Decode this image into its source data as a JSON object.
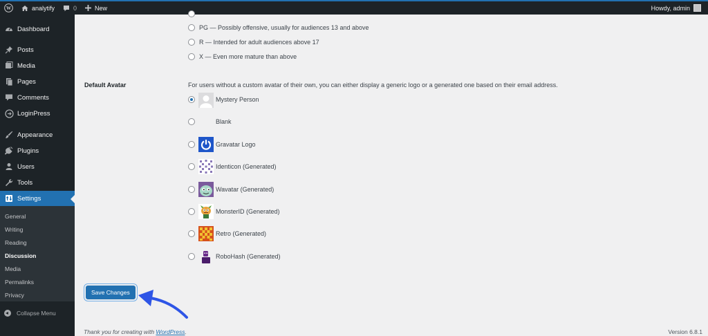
{
  "adminbar": {
    "site_name": "analytify",
    "comments_count": "0",
    "new_label": "New",
    "howdy": "Howdy, admin"
  },
  "sidebar": {
    "items": [
      {
        "label": "Dashboard",
        "icon": "dashboard-icon"
      },
      {
        "label": "Posts",
        "icon": "pin-icon"
      },
      {
        "label": "Media",
        "icon": "media-icon"
      },
      {
        "label": "Pages",
        "icon": "pages-icon"
      },
      {
        "label": "Comments",
        "icon": "comment-icon"
      },
      {
        "label": "LoginPress",
        "icon": "loginpress-icon"
      },
      {
        "label": "Appearance",
        "icon": "brush-icon"
      },
      {
        "label": "Plugins",
        "icon": "plugin-icon"
      },
      {
        "label": "Users",
        "icon": "users-icon"
      },
      {
        "label": "Tools",
        "icon": "wrench-icon"
      },
      {
        "label": "Settings",
        "icon": "settings-icon",
        "active": true
      }
    ],
    "submenu": [
      "General",
      "Writing",
      "Reading",
      "Discussion",
      "Media",
      "Permalinks",
      "Privacy"
    ],
    "submenu_current": "Discussion",
    "collapse_label": "Collapse Menu"
  },
  "rating": {
    "options": [
      {
        "label": "PG — Possibly offensive, usually for audiences 13 and above",
        "checked": false
      },
      {
        "label": "R — Intended for adult audiences above 17",
        "checked": false
      },
      {
        "label": "X — Even more mature than above",
        "checked": false
      }
    ]
  },
  "avatar": {
    "row_label": "Default Avatar",
    "description": "For users without a custom avatar of their own, you can either display a generic logo or a generated one based on their email address.",
    "options": [
      {
        "label": "Mystery Person",
        "checked": true
      },
      {
        "label": "Blank",
        "checked": false
      },
      {
        "label": "Gravatar Logo",
        "checked": false
      },
      {
        "label": "Identicon (Generated)",
        "checked": false
      },
      {
        "label": "Wavatar (Generated)",
        "checked": false
      },
      {
        "label": "MonsterID (Generated)",
        "checked": false
      },
      {
        "label": "Retro (Generated)",
        "checked": false
      },
      {
        "label": "RoboHash (Generated)",
        "checked": false
      }
    ]
  },
  "save_label": "Save Changes",
  "footer": {
    "thanks_prefix": "Thank you for creating with ",
    "thanks_link": "WordPress",
    "thanks_suffix": ".",
    "version": "Version 6.8.1"
  },
  "colors": {
    "accent": "#2271b1",
    "sidebar_bg": "#1d2327",
    "page_bg": "#f0f0f1",
    "annotation_arrow": "#2e55e6"
  }
}
